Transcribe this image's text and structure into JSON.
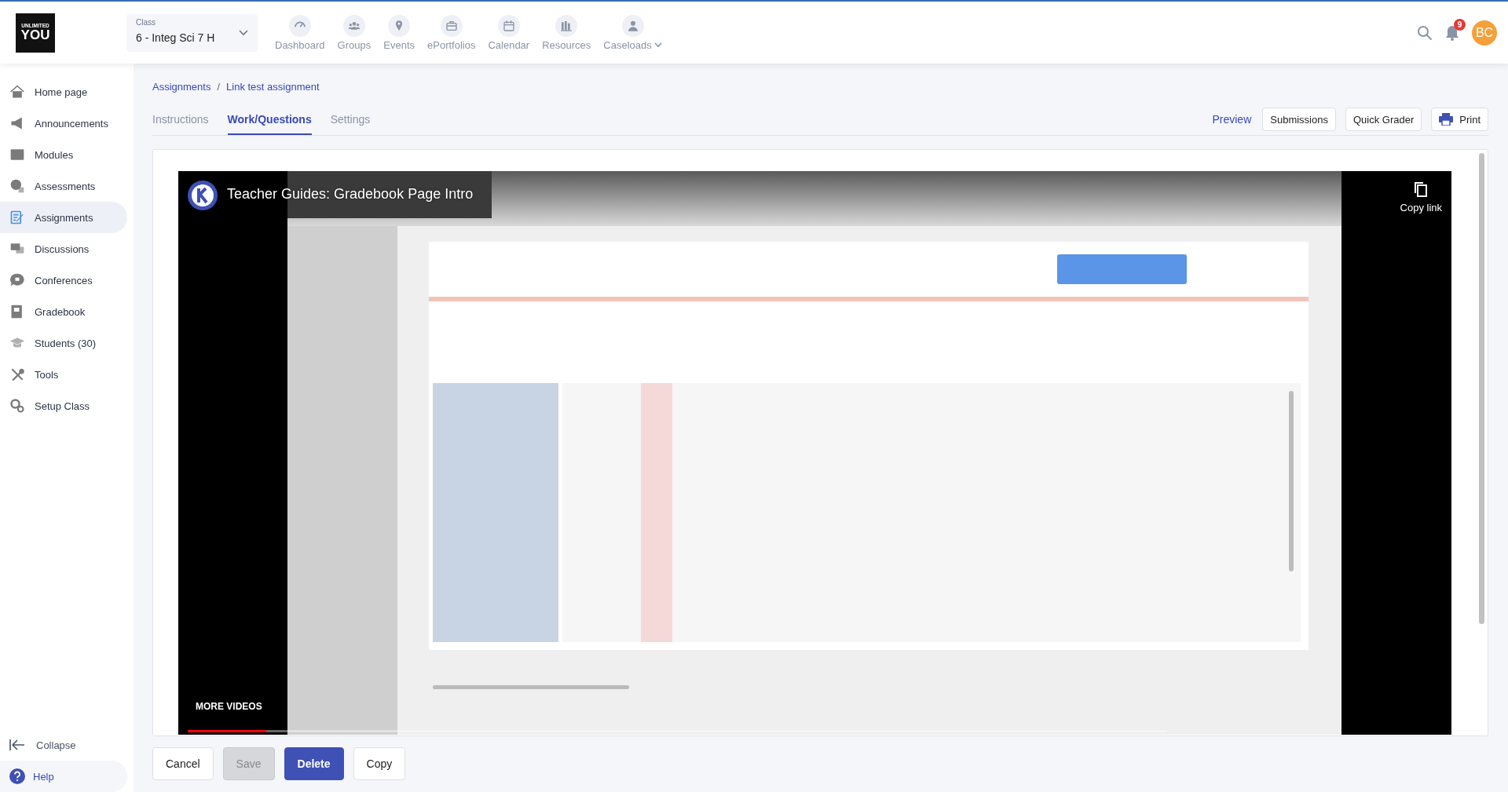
{
  "header": {
    "logo": {
      "line1": "UNLIMITED",
      "line2": "YOU"
    },
    "class_selector": {
      "label": "Class",
      "value": "6 - Integ Sci 7 H"
    },
    "nav": [
      {
        "label": "Dashboard",
        "has_menu": false
      },
      {
        "label": "Groups",
        "has_menu": false
      },
      {
        "label": "Events",
        "has_menu": false
      },
      {
        "label": "ePortfolios",
        "has_menu": false
      },
      {
        "label": "Calendar",
        "has_menu": false
      },
      {
        "label": "Resources",
        "has_menu": false
      },
      {
        "label": "Caseloads",
        "has_menu": true
      }
    ],
    "notifications": "9",
    "avatar": "BC"
  },
  "sidebar": {
    "items": [
      {
        "label": "Home page",
        "selected": false
      },
      {
        "label": "Announcements",
        "selected": false
      },
      {
        "label": "Modules",
        "selected": false
      },
      {
        "label": "Assessments",
        "selected": false
      },
      {
        "label": "Assignments",
        "selected": true
      },
      {
        "label": "Discussions",
        "selected": false
      },
      {
        "label": "Conferences",
        "selected": false
      },
      {
        "label": "Gradebook",
        "selected": false
      },
      {
        "label": "Students (30)",
        "selected": false
      },
      {
        "label": "Tools",
        "selected": false
      },
      {
        "label": "Setup Class",
        "selected": false
      }
    ],
    "collapse": "Collapse",
    "help": "Help"
  },
  "breadcrumb": {
    "items": [
      "Assignments",
      "Link test assignment"
    ],
    "separator": "/"
  },
  "tabs": [
    {
      "label": "Instructions",
      "selected": false
    },
    {
      "label": "Work/Questions",
      "selected": true
    },
    {
      "label": "Settings",
      "selected": false
    }
  ],
  "actions": [
    {
      "label": "Preview",
      "kind": "link"
    },
    {
      "label": "Submissions",
      "kind": "button"
    },
    {
      "label": "Quick Grader",
      "kind": "button"
    },
    {
      "label": "Print",
      "kind": "print"
    }
  ],
  "video": {
    "kind": "picture",
    "title": "Teacher Guides: Gradebook Page Intro",
    "copy_link": "Copy link",
    "more_videos": "MORE VIDEOS",
    "progress": {
      "level": 0.08
    }
  },
  "footer_buttons": [
    {
      "label": "Cancel",
      "kind": "default",
      "disabled": false
    },
    {
      "label": "Save",
      "kind": "default",
      "disabled": true
    },
    {
      "label": "Delete",
      "kind": "primary",
      "disabled": false
    },
    {
      "label": "Copy",
      "kind": "default",
      "disabled": false
    }
  ]
}
